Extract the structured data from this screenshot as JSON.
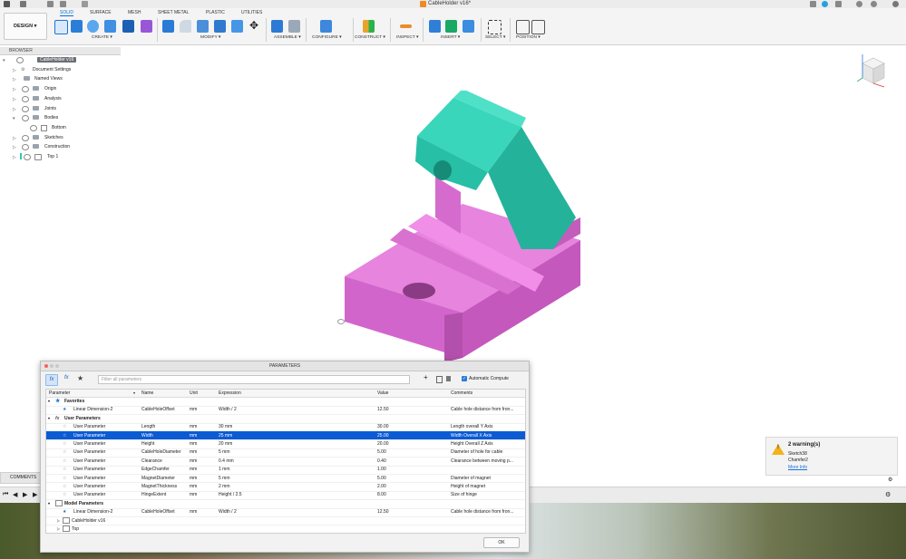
{
  "window": {
    "title": "CableHolder v16*"
  },
  "tabs": [
    "SOLID",
    "SURFACE",
    "MESH",
    "SHEET METAL",
    "PLASTIC",
    "UTILITIES"
  ],
  "active_tab": "SOLID",
  "workspace": {
    "label": "DESIGN ▾"
  },
  "ribbon_groups": [
    "CREATE ▾",
    "MODIFY ▾",
    "ASSEMBLE ▾",
    "CONFIGURE ▾",
    "CONSTRUCT ▾",
    "INSPECT ▾",
    "INSERT ▾",
    "SELECT ▾",
    "POSITION ▾"
  ],
  "browser": {
    "header": "BROWSER",
    "root": "CableHolder v16",
    "items": [
      "Document Settings",
      "Named Views",
      "Origin",
      "Analysis",
      "Joints",
      "Bodies",
      "Bottom",
      "Sketches",
      "Construction",
      "Top 1"
    ]
  },
  "parameters": {
    "title": "PARAMETERS",
    "search_placeholder": "Filter all parameters",
    "auto_compute": "Automatic Compute",
    "columns": [
      "Parameter",
      "Name",
      "Unit",
      "Expression",
      "Value",
      "Comments"
    ],
    "sections": {
      "favorites": "Favorites",
      "user": "User Parameters",
      "model": "Model Parameters"
    },
    "favorites": [
      {
        "param": "Linear Dimension-2",
        "name": "CableHoleOffset",
        "unit": "mm",
        "expr": "Width / 2",
        "value": "12.50",
        "comment": "Cable hole distance from fron..."
      }
    ],
    "user": [
      {
        "param": "User Parameter",
        "name": "Length",
        "unit": "mm",
        "expr": "30 mm",
        "value": "30.00",
        "comment": "Length overall Y Axis"
      },
      {
        "param": "User Parameter",
        "name": "Width",
        "unit": "mm",
        "expr": "25 mm",
        "value": "25.00",
        "comment": "Width Overall X Axis"
      },
      {
        "param": "User Parameter",
        "name": "Height",
        "unit": "mm",
        "expr": "20 mm",
        "value": "20.00",
        "comment": "Height Overall Z Axis"
      },
      {
        "param": "User Parameter",
        "name": "CableHoleDiameter",
        "unit": "mm",
        "expr": "5 mm",
        "value": "5.00",
        "comment": "Diameter of hole for cable"
      },
      {
        "param": "User Parameter",
        "name": "Clearance",
        "unit": "mm",
        "expr": "0.4 mm",
        "value": "0.40",
        "comment": "Clearance between moving p..."
      },
      {
        "param": "User Parameter",
        "name": "EdgeChamfer",
        "unit": "mm",
        "expr": "1 mm",
        "value": "1.00",
        "comment": ""
      },
      {
        "param": "User Parameter",
        "name": "MagnetDiameter",
        "unit": "mm",
        "expr": "5 mm",
        "value": "5.00",
        "comment": "Diameter of magnet"
      },
      {
        "param": "User Parameter",
        "name": "MagnetThickness",
        "unit": "mm",
        "expr": "2 mm",
        "value": "2.00",
        "comment": "Height of magnet"
      },
      {
        "param": "User Parameter",
        "name": "HingeExtent",
        "unit": "mm",
        "expr": "Height / 2.5",
        "value": "8.00",
        "comment": "Size of hinge"
      }
    ],
    "model": [
      {
        "param": "Linear Dimension-2",
        "name": "CableHoleOffset",
        "unit": "mm",
        "expr": "Width / 2",
        "value": "12.50",
        "comment": "Cable hole distance from fron..."
      }
    ],
    "model_children": [
      "CableHolder v16",
      "Top"
    ],
    "ok": "OK"
  },
  "warnings": {
    "title": "2 warning(s)",
    "items": [
      "Sketch38",
      "Chamfer2"
    ],
    "link": "More Info"
  },
  "comments_label": "COMMENTS",
  "colors": {
    "top_body": "#2ec9b0",
    "bottom_body": "#d96ad2",
    "accent": "#0b5bd3"
  }
}
